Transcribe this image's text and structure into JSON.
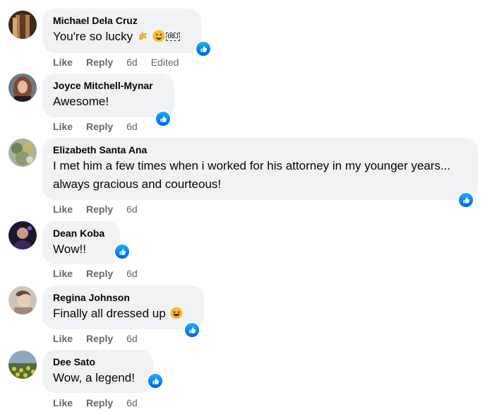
{
  "comments": [
    {
      "author": "Michael Dela Cruz",
      "text": "You're so lucky",
      "emojis": [
        "call-me-hand-emoji",
        "grinning-face-emoji"
      ],
      "obj_label": "OBJ",
      "like_label": "Like",
      "reply_label": "Reply",
      "time": "6d",
      "edited": "Edited",
      "reaction": "like",
      "colors": {
        "avatar": "#6b4a2e"
      }
    },
    {
      "author": "Joyce Mitchell-Mynar",
      "text": "Awesome!",
      "like_label": "Like",
      "reply_label": "Reply",
      "time": "6d",
      "reaction": "like",
      "colors": {
        "avatar": "#8a5a44"
      }
    },
    {
      "author": "Elizabeth Santa Ana",
      "text": "I met him a few times when i worked for his attorney in my younger years... always gracious and courteous!",
      "like_label": "Like",
      "reply_label": "Reply",
      "time": "6d",
      "reaction": "like",
      "colors": {
        "avatar": "#7d8c5a"
      }
    },
    {
      "author": "Dean Koba",
      "text": "Wow!!",
      "like_label": "Like",
      "reply_label": "Reply",
      "time": "6d",
      "reaction": "like",
      "colors": {
        "avatar": "#2b1f3f"
      }
    },
    {
      "author": "Regina Johnson",
      "text": "Finally all dressed up",
      "emojis": [
        "laughing-squinting-face-emoji"
      ],
      "like_label": "Like",
      "reply_label": "Reply",
      "time": "6d",
      "reaction": "like",
      "colors": {
        "avatar": "#b09c8c"
      }
    },
    {
      "author": "Dee Sato",
      "text": "Wow, a legend!",
      "like_label": "Like",
      "reply_label": "Reply",
      "time": "6d",
      "reaction": "like",
      "colors": {
        "avatar": "#4f6e3a"
      }
    }
  ],
  "theme": {
    "bubble_bg": "#f0f2f5",
    "meta_text": "#65676b",
    "like_blue": "#0866ff"
  }
}
